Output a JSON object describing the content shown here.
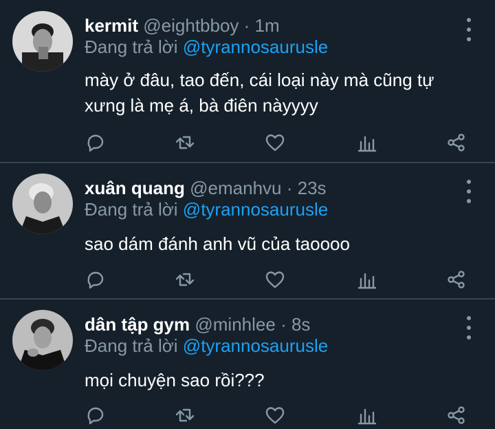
{
  "reply_prefix": "Đang trả lời",
  "tweets": [
    {
      "name": "kermit",
      "handle": "@eightbboy",
      "time": "· 1m",
      "mention": "@tyrannosaurusle",
      "text": "mày ở đâu, tao đến, cái loại này mà cũng tự xưng là mẹ á, bà điên nàyyyy"
    },
    {
      "name": "xuân quang",
      "handle": "@emanhvu",
      "time": "· 23s",
      "mention": "@tyrannosaurusle",
      "text": "sao dám đánh anh vũ của taoooo"
    },
    {
      "name": "dân tập gym",
      "handle": "@minhlee",
      "time": "· 8s",
      "mention": "@tyrannosaurusle",
      "text": "mọi chuyện sao rồi???"
    }
  ],
  "icons": [
    "reply-icon",
    "retweet-icon",
    "like-icon",
    "analytics-icon",
    "share-icon",
    "more-icon"
  ],
  "colors": {
    "background": "#15202b",
    "secondary_text": "#8899a6",
    "mention": "#1da1f2",
    "divider": "#38444d"
  }
}
